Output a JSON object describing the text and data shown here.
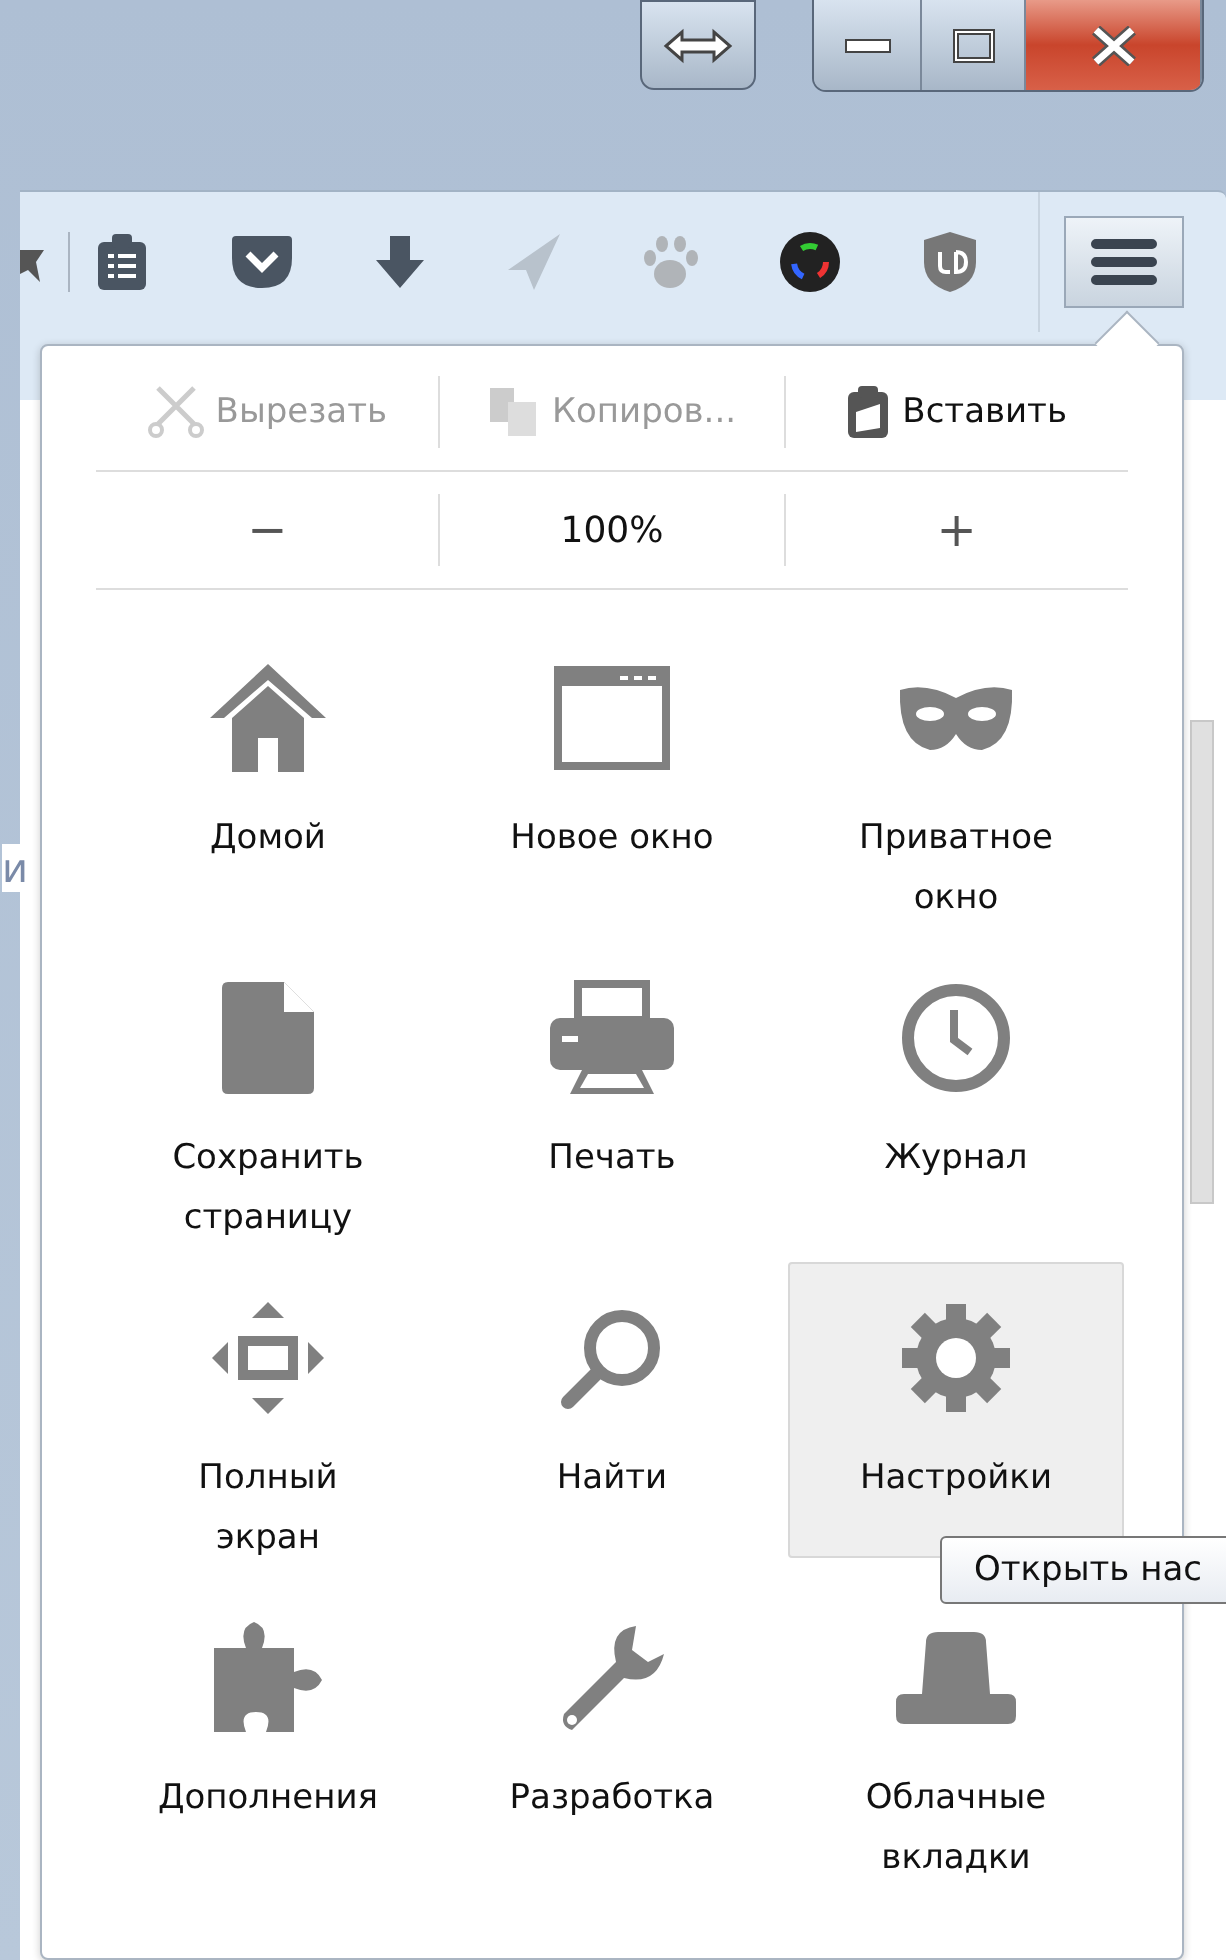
{
  "page": {
    "text_fragment": "и"
  },
  "edit_row": [
    {
      "kind": "cut",
      "label": "Вырезать",
      "disabled": true
    },
    {
      "kind": "copy",
      "label": "Копиров...",
      "disabled": true
    },
    {
      "kind": "paste",
      "label": "Вставить",
      "disabled": false
    }
  ],
  "zoom_row": {
    "minus": "−",
    "value": "100%",
    "plus": "+"
  },
  "items": [
    {
      "kind": "home",
      "label": "Домой",
      "hovered": false
    },
    {
      "kind": "window",
      "label": "Новое окно",
      "hovered": false
    },
    {
      "kind": "mask",
      "label": "Приватное окно",
      "hovered": false
    },
    {
      "kind": "page",
      "label": "Сохранить страницу",
      "hovered": false
    },
    {
      "kind": "printer",
      "label": "Печать",
      "hovered": false
    },
    {
      "kind": "clock",
      "label": "Журнал",
      "hovered": false
    },
    {
      "kind": "move",
      "label": "Полный экран",
      "hovered": false
    },
    {
      "kind": "search",
      "label": "Найти",
      "hovered": false
    },
    {
      "kind": "gear",
      "label": "Настройки",
      "hovered": true
    },
    {
      "kind": "puzzle",
      "label": "Дополнения",
      "hovered": false
    },
    {
      "kind": "wrench",
      "label": "Разработка",
      "hovered": false
    },
    {
      "kind": "hat",
      "label": "Облачные вкладки",
      "hovered": false
    }
  ],
  "tooltip": "Открыть нас"
}
